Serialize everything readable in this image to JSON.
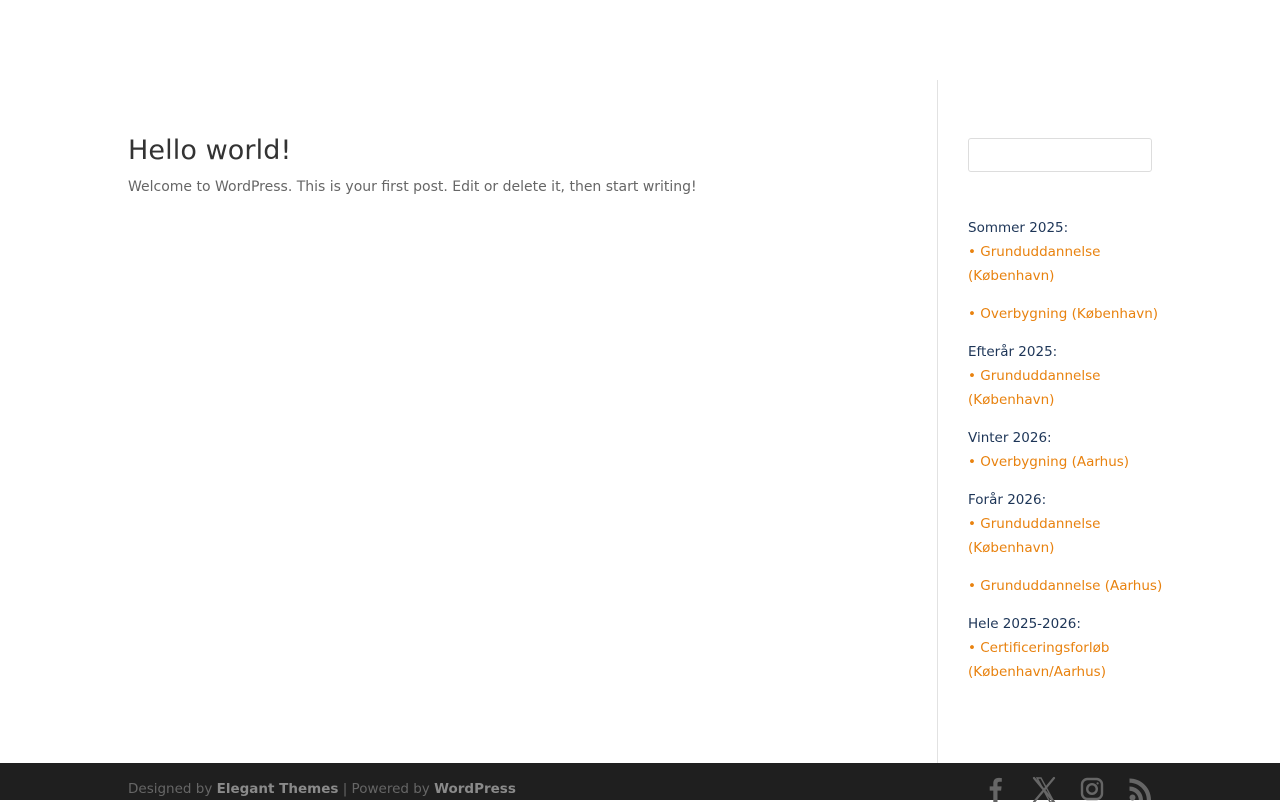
{
  "post": {
    "title": "Hello world!",
    "excerpt": "Welcome to WordPress. This is your first post. Edit or delete it, then start writing!"
  },
  "sidebar": {
    "search": {
      "value": "",
      "placeholder": ""
    },
    "schedule": [
      {
        "heading": "Sommer 2025:",
        "courses": [
          "• Grunduddannelse (København)",
          "• Overbygning (København)"
        ]
      },
      {
        "heading": "Efterår 2025:",
        "courses": [
          "• Grunduddannelse (København)"
        ]
      },
      {
        "heading": "Vinter 2026:",
        "courses": [
          "• Overbygning (Aarhus)"
        ]
      },
      {
        "heading": "Forår 2026:",
        "courses": [
          "• Grunduddannelse (København)",
          "• Grunduddannelse (Aarhus)"
        ]
      },
      {
        "heading": "Hele 2025-2026:",
        "courses": [
          "• Certificeringsforløb (København/Aarhus)"
        ]
      }
    ]
  },
  "footer": {
    "designed_by_prefix": "Designed by ",
    "designer": "Elegant Themes",
    "separator": " | Powered by ",
    "platform": "WordPress",
    "social": [
      {
        "name": "facebook-icon"
      },
      {
        "name": "x-icon"
      },
      {
        "name": "instagram-icon"
      },
      {
        "name": "rss-icon"
      }
    ]
  },
  "colors": {
    "link": "#e8820f",
    "heading": "#1d3557",
    "footer_bg": "#1f1f1f",
    "footer_icon": "#666666"
  }
}
